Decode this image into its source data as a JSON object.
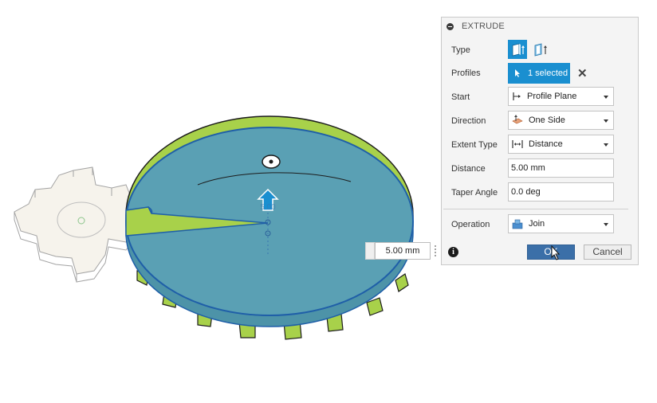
{
  "dialog": {
    "title": "EXTRUDE",
    "labels": {
      "type": "Type",
      "profiles": "Profiles",
      "start": "Start",
      "direction": "Direction",
      "extent_type": "Extent Type",
      "distance": "Distance",
      "taper_angle": "Taper Angle",
      "operation": "Operation"
    },
    "profiles_value": "1 selected",
    "start_value": "Profile Plane",
    "direction_value": "One Side",
    "extent_type_value": "Distance",
    "distance_value": "5.00 mm",
    "taper_angle_value": "0.0 deg",
    "operation_value": "Join",
    "ok_label": "OK",
    "cancel_label": "Cancel",
    "info_glyph": "i",
    "clear_glyph": "✕"
  },
  "viewport": {
    "distance_callout_value": "5.00 mm",
    "manipulator_label": "5.00",
    "colors": {
      "face_blue": "#5aa0b4",
      "edge_blue": "#1f5fa8",
      "rim_green": "#a8d14a",
      "accent": "#1a8fd0"
    }
  }
}
